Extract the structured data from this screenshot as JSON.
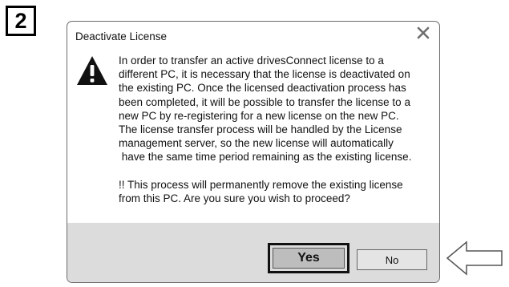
{
  "step": {
    "number": "2"
  },
  "dialog": {
    "title": "Deactivate License",
    "close_icon": "close-x-icon",
    "warning_icon": "warning-triangle-icon",
    "message_paragraph_1": [
      "In order to transfer an active drivesConnect license to a",
      "different PC, it is necessary that the license is deactivated on",
      "the existing PC.  Once the licensed deactivation process has",
      "been completed, it will be possible to transfer the license to a",
      "new PC by re-registering for a new license on the new PC.",
      "The license transfer process will be handled by the License",
      "management server, so the new license will automatically",
      " have the same time period remaining as the existing license."
    ],
    "message_paragraph_2": [
      "!! This process will permanently remove the existing license",
      "from this PC. Are you sure you wish to proceed?"
    ],
    "yes_label": "Yes",
    "no_label": "No"
  },
  "annotation": {
    "pointer_icon": "left-arrow-icon"
  },
  "colors": {
    "footer_bg": "#dcdcdc",
    "yes_bg": "#bdbdbd",
    "no_bg": "#e4e4e4",
    "border": "#6a6a6a"
  }
}
